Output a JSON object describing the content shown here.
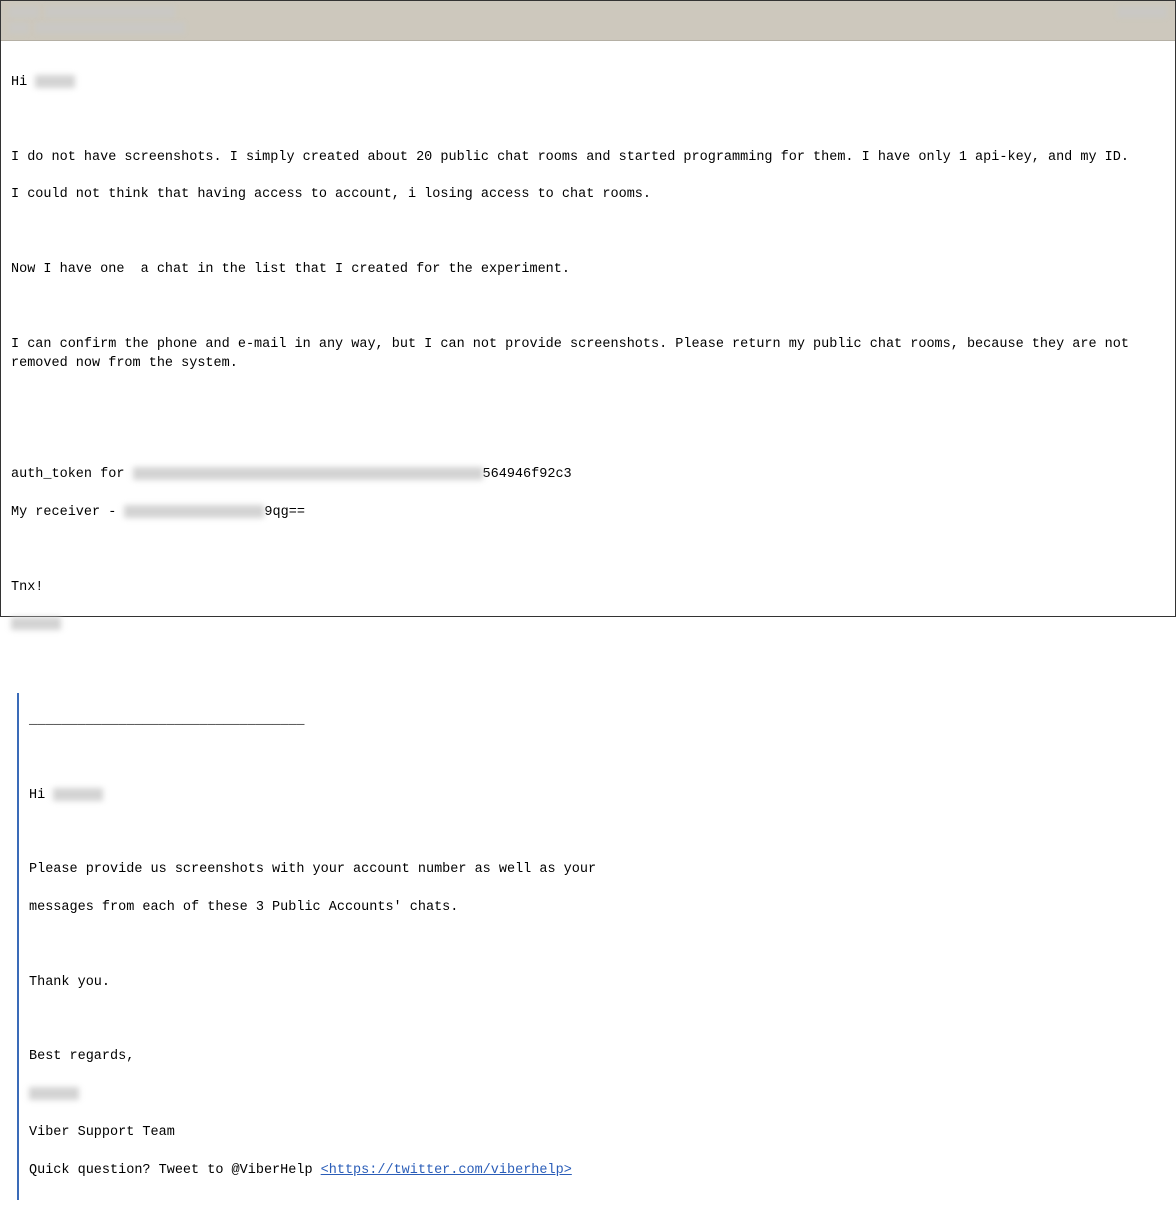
{
  "header": {
    "to_blur_width1": 30,
    "to_blur_width2": 130,
    "subject_blur_width1": 20,
    "subject_blur_width2": 150,
    "right_blur_width": 50
  },
  "body": {
    "greeting_prefix": "Hi ",
    "greeting_blur_width": 40,
    "p1": "I do not have screenshots. I simply created about 20 public chat rooms and started programming for them. I have only 1 api-key, and my ID.",
    "p2": "I could not think that having access to account, i losing access to chat rooms.",
    "p3": "Now I have one  a chat in the list that I created for the experiment.",
    "p4": "I can confirm the phone and e-mail in any way, but I can not provide screenshots. Please return my public chat rooms, because they are not removed now from the system.",
    "auth_prefix": "auth_token for ",
    "auth_blur_width": 350,
    "auth_suffix": "564946f92c3",
    "recv_prefix": "My receiver - ",
    "recv_blur_width": 140,
    "recv_suffix": "9qg==",
    "tnx": "Tnx!",
    "sig_blur_width": 50
  },
  "quote": {
    "divider": "__________________________________",
    "greeting_prefix": "Hi ",
    "greeting_blur_width": 50,
    "p1": "Please provide us screenshots with your account number as well as your",
    "p2": "messages from each of these 3 Public Accounts' chats.",
    "thank": "Thank you.",
    "regards": "Best regards,",
    "sig_blur_width": 50,
    "team": "Viber Support Team",
    "quick_prefix": "Quick question? Tweet to @ViberHelp ",
    "link_text": "<https://twitter.com/viberhelp>"
  }
}
